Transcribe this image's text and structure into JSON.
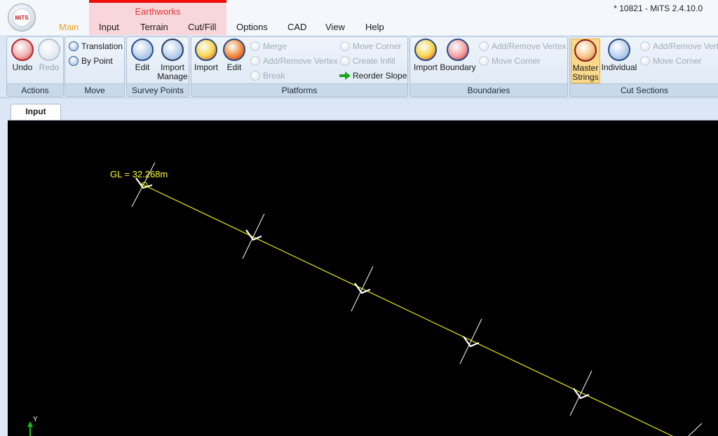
{
  "window": {
    "title": "* 10821 - MiTS 2.4.10.0",
    "logo_text": "MiTS"
  },
  "context_group": {
    "label": "Earthworks",
    "color": "#f20d0d"
  },
  "menu": {
    "main": "Main",
    "input": "Input",
    "terrain": "Terrain",
    "cutfill": "Cut/Fill",
    "options": "Options",
    "cad": "CAD",
    "view": "View",
    "help": "Help"
  },
  "ribbon": {
    "actions": {
      "label": "Actions",
      "undo": "Undo",
      "redo": "Redo"
    },
    "move": {
      "label": "Move",
      "translation": "Translation",
      "by_point": "By Point"
    },
    "survey_points": {
      "label": "Survey Points",
      "edit": "Edit",
      "import_manage_1": "Import",
      "import_manage_2": "Manage"
    },
    "platforms": {
      "label": "Platforms",
      "import": "Import",
      "edit": "Edit",
      "merge": "Merge",
      "add_remove_vertex": "Add/Remove Vertex",
      "break": "Break",
      "move_corner": "Move Corner",
      "create_infill": "Create Infill",
      "reorder_slope": "Reorder Slope"
    },
    "boundaries": {
      "label": "Boundaries",
      "import": "Import",
      "boundary": "Boundary",
      "add_remove_vertex": "Add/Remove Vertex",
      "move_corner": "Move Corner"
    },
    "cut_sections": {
      "label": "Cut Sections",
      "master_strings_1": "Master",
      "master_strings_2": "Strings",
      "individual": "Individual",
      "add_remove_vertex": "Add/Remove Vertex",
      "move_corner": "Move Corner"
    }
  },
  "document_tabs": {
    "input": "Input"
  },
  "canvas": {
    "gl_label": "GL = 32.268m",
    "axis_y": "Y",
    "line_color": "#e6e600",
    "label_color": "#ffff2e"
  }
}
